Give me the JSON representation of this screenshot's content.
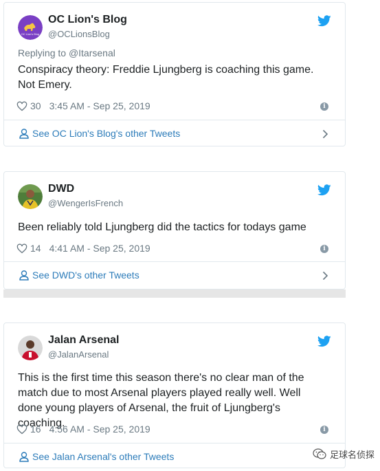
{
  "tweets": [
    {
      "name": "OC Lion's Blog",
      "handle": "@OCLionsBlog",
      "avatar_text": "OC Lion's Blog",
      "reply_prefix": "Replying to ",
      "reply_to": "@Itarsenal",
      "text": "Conspiracy theory: Freddie Ljungberg is coaching this game. Not Emery.",
      "likes": "30",
      "timestamp": "3:45 AM - Sep 25, 2019",
      "footer_link": "See OC Lion's Blog's other Tweets"
    },
    {
      "name": "DWD",
      "handle": "@WengerIsFrench",
      "text": "Been reliably told Ljungberg did the tactics for todays game",
      "likes": "14",
      "timestamp": "4:41 AM - Sep 25, 2019",
      "footer_link": "See DWD's other Tweets"
    },
    {
      "name": "Jalan Arsenal",
      "handle": "@JalanArsenal",
      "text": "This is the first time this season there's no clear man of the match due to most Arsenal players played really well. Well done young players of Arsenal, the fruit of Ljungberg's coaching.",
      "likes": "16",
      "timestamp": "4:56 AM - Sep 25, 2019",
      "footer_link": "See Jalan Arsenal's other Tweets"
    }
  ],
  "watermark": "足球名侦探",
  "colors": {
    "accent": "#2b7bb9",
    "twitter_bird": "#1da1f2",
    "muted": "#697882",
    "border": "#e1e8ed",
    "oc_avatar_bg": "#7a3fc4"
  },
  "icons": [
    "twitter-bird-icon",
    "heart-icon",
    "info-icon",
    "person-icon",
    "chevron-right-icon",
    "wechat-icon"
  ]
}
